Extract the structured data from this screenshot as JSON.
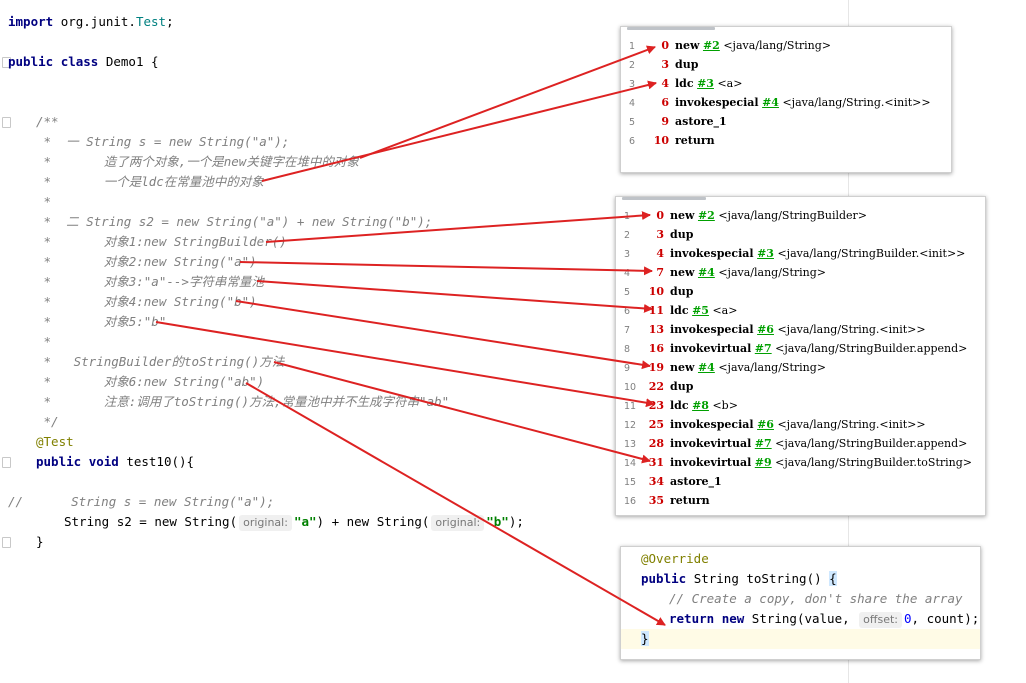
{
  "source": {
    "import_kw": "import",
    "import_pkg": "org.junit.",
    "import_cls": "Test",
    "import_end": ";",
    "public_kw": "public",
    "class_kw": "class",
    "class_name": "Demo1 {",
    "doc_open": "/**",
    "c1": " *  一 String s = new String(\"a\");",
    "c2": " *       造了两个对象,一个是new关键字在堆中的对象",
    "c3": " *       一个是ldc在常量池中的对象",
    "c4": " *",
    "c5": " *  二 String s2 = new String(\"a\") + new String(\"b\");",
    "c6": " *       对象1:new StringBuilder()",
    "c7": " *       对象2:new String(\"a\")",
    "c8": " *       对象3:\"a\"-->字符串常量池",
    "c9": " *       对象4:new String(\"b\")",
    "c10": " *       对象5:\"b\"",
    "c11": " *",
    "c12": " *   StringBuilder的toString()方法",
    "c13": " *       对象6:new String(\"ab\")",
    "c14": " *       注意:调用了toString()方法,常量池中并不生成字符串\"ab\"",
    "doc_close": " */",
    "annotation": "@Test",
    "method_public": "public",
    "method_void": "void",
    "method_name": "test10(){",
    "commented_prefix": "//",
    "commented_code": "String s = new String(\"a\");",
    "s2_type": "String",
    "s2_decl": "s2 = new String(",
    "hint_original": "original:",
    "s2_a": "\"a\"",
    "s2_mid": ") + new String(",
    "s2_b": "\"b\"",
    "s2_end": ");",
    "close_brace": "}"
  },
  "bytecode1": {
    "rows": [
      {
        "ln": "1",
        "off": "0",
        "op": "new",
        "ref": "#2",
        "arg": "<java/lang/String>"
      },
      {
        "ln": "2",
        "off": "3",
        "op": "dup",
        "ref": "",
        "arg": ""
      },
      {
        "ln": "3",
        "off": "4",
        "op": "ldc",
        "ref": "#3",
        "arg": "<a>"
      },
      {
        "ln": "4",
        "off": "6",
        "op": "invokespecial",
        "ref": "#4",
        "arg": "<java/lang/String.<init>>"
      },
      {
        "ln": "5",
        "off": "9",
        "op": "astore_1",
        "ref": "",
        "arg": ""
      },
      {
        "ln": "6",
        "off": "10",
        "op": "return",
        "ref": "",
        "arg": ""
      }
    ]
  },
  "bytecode2": {
    "rows": [
      {
        "ln": "1",
        "off": "0",
        "op": "new",
        "ref": "#2",
        "arg": "<java/lang/StringBuilder>"
      },
      {
        "ln": "2",
        "off": "3",
        "op": "dup",
        "ref": "",
        "arg": ""
      },
      {
        "ln": "3",
        "off": "4",
        "op": "invokespecial",
        "ref": "#3",
        "arg": "<java/lang/StringBuilder.<init>>"
      },
      {
        "ln": "4",
        "off": "7",
        "op": "new",
        "ref": "#4",
        "arg": "<java/lang/String>"
      },
      {
        "ln": "5",
        "off": "10",
        "op": "dup",
        "ref": "",
        "arg": ""
      },
      {
        "ln": "6",
        "off": "11",
        "op": "ldc",
        "ref": "#5",
        "arg": "<a>"
      },
      {
        "ln": "7",
        "off": "13",
        "op": "invokespecial",
        "ref": "#6",
        "arg": "<java/lang/String.<init>>"
      },
      {
        "ln": "8",
        "off": "16",
        "op": "invokevirtual",
        "ref": "#7",
        "arg": "<java/lang/StringBuilder.append>"
      },
      {
        "ln": "9",
        "off": "19",
        "op": "new",
        "ref": "#4",
        "arg": "<java/lang/String>"
      },
      {
        "ln": "10",
        "off": "22",
        "op": "dup",
        "ref": "",
        "arg": ""
      },
      {
        "ln": "11",
        "off": "23",
        "op": "ldc",
        "ref": "#8",
        "arg": "<b>"
      },
      {
        "ln": "12",
        "off": "25",
        "op": "invokespecial",
        "ref": "#6",
        "arg": "<java/lang/String.<init>>"
      },
      {
        "ln": "13",
        "off": "28",
        "op": "invokevirtual",
        "ref": "#7",
        "arg": "<java/lang/StringBuilder.append>"
      },
      {
        "ln": "14",
        "off": "31",
        "op": "invokevirtual",
        "ref": "#9",
        "arg": "<java/lang/StringBuilder.toString>"
      },
      {
        "ln": "15",
        "off": "34",
        "op": "astore_1",
        "ref": "",
        "arg": ""
      },
      {
        "ln": "16",
        "off": "35",
        "op": "return",
        "ref": "",
        "arg": ""
      }
    ]
  },
  "tostring": {
    "annotation": "@Override",
    "sig_public": "public",
    "sig_rest": "String toString() ",
    "brace_open": "{",
    "comment": "// Create a copy, don't share the array",
    "ret_kw": "return",
    "ret_new": "new",
    "ret_call": "String(value, ",
    "hint_offset": "offset:",
    "ret_zero": "0",
    "ret_end": ", count);",
    "brace_close": "}"
  },
  "colors": {
    "keyword": "#000080",
    "string": "#008000",
    "comment": "#808080",
    "annotation": "#808000",
    "arrow": "#dd2222",
    "bc_offset": "#cc0000",
    "bc_ref": "#00a000"
  }
}
